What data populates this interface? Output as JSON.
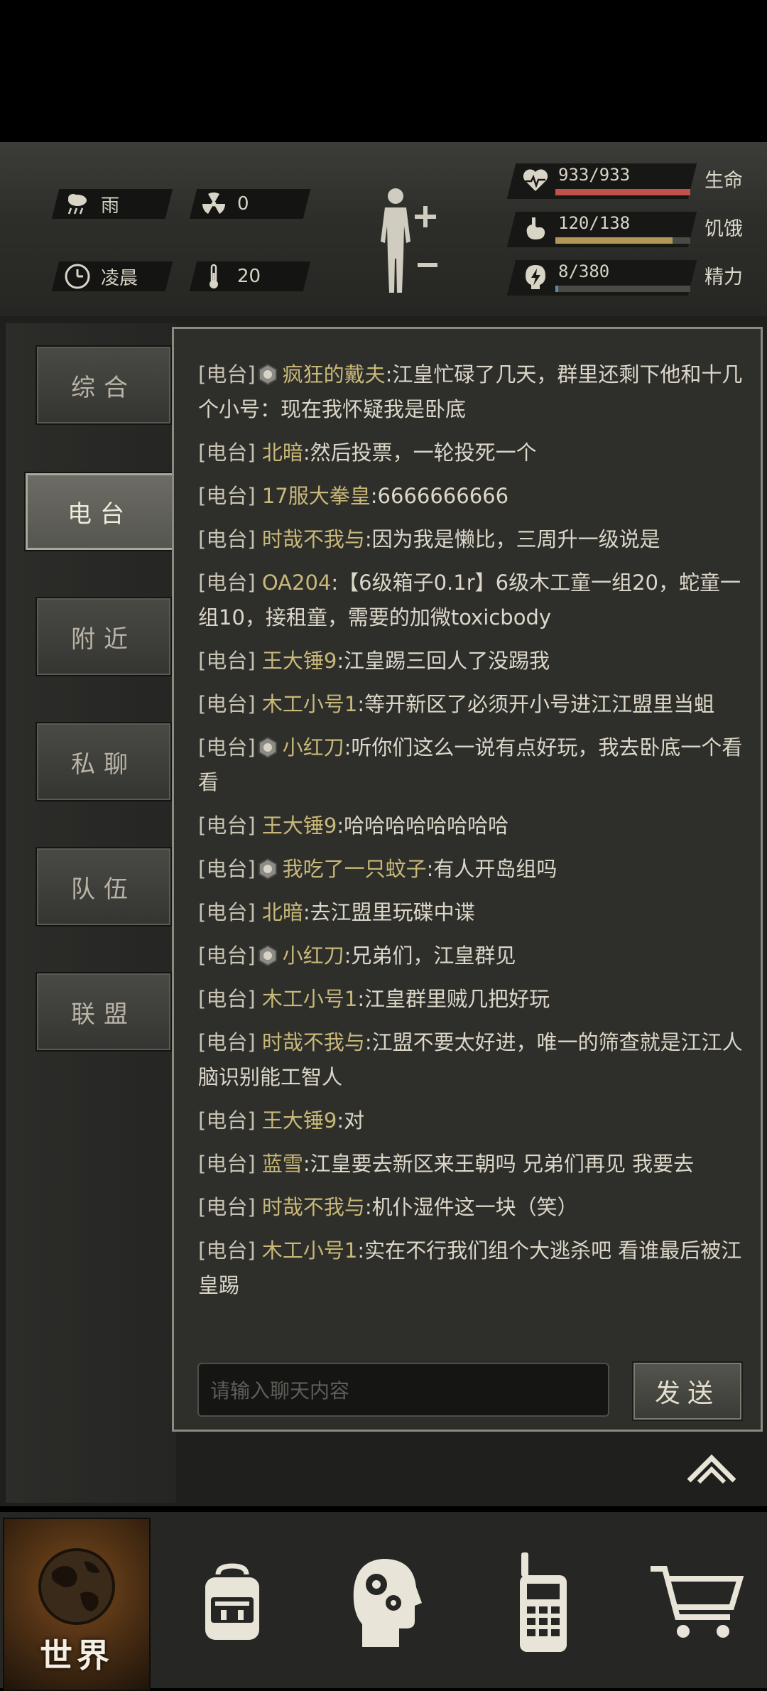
{
  "hud": {
    "weather": {
      "label": "雨",
      "icon": "rain-icon"
    },
    "radiation": {
      "value": "0",
      "icon": "radiation-icon"
    },
    "time_of_day": {
      "label": "凌晨",
      "icon": "clock-icon"
    },
    "temperature": {
      "value": "20",
      "icon": "thermometer-icon"
    },
    "stats": [
      {
        "name": "生命",
        "value": "933/933",
        "fraction": 1.0,
        "color": "#c0524a",
        "icon": "heart-pulse-icon"
      },
      {
        "name": "饥饿",
        "value": "120/138",
        "fraction": 0.87,
        "color": "#b39658",
        "icon": "stomach-icon"
      },
      {
        "name": "精力",
        "value": "8/380",
        "fraction": 0.02,
        "color": "#5a8ab0",
        "icon": "energy-icon"
      }
    ]
  },
  "tabs": [
    {
      "label": "综合",
      "active": false
    },
    {
      "label": "电台",
      "active": true
    },
    {
      "label": "附近",
      "active": false
    },
    {
      "label": "私聊",
      "active": false
    },
    {
      "label": "队伍",
      "active": false
    },
    {
      "label": "联盟",
      "active": false
    }
  ],
  "chat": {
    "channel": "[电台]",
    "messages": [
      {
        "name": "疯狂的戴夫",
        "text": ":江皇忙碌了几天，群里还剩下他和十几个小号：现在我怀疑我是卧底",
        "badge": true
      },
      {
        "name": "北暗",
        "text": ":然后投票，一轮投死一个",
        "badge": false
      },
      {
        "name": "17服大拳皇",
        "text": ":6666666666",
        "badge": false
      },
      {
        "name": "时哉不我与",
        "text": ":因为我是懒比，三周升一级说是",
        "badge": false
      },
      {
        "name": "OA204",
        "text": ":【6级箱子0.1r】6级木工童一组20，蛇童一组10，接租童，需要的加微toxicbody",
        "badge": false
      },
      {
        "name": "王大锤9",
        "text": ":江皇踢三回人了没踢我",
        "badge": false
      },
      {
        "name": "木工小号1",
        "text": ":等开新区了必须开小号进江江盟里当蛆",
        "badge": false
      },
      {
        "name": "小红刀",
        "text": ":听你们这么一说有点好玩，我去卧底一个看看",
        "badge": true
      },
      {
        "name": "王大锤9",
        "text": ":哈哈哈哈哈哈哈哈",
        "badge": false
      },
      {
        "name": "我吃了一只蚊子",
        "text": ":有人开岛组吗",
        "badge": true
      },
      {
        "name": "北暗",
        "text": ":去江盟里玩碟中谍",
        "badge": false
      },
      {
        "name": "小红刀",
        "text": ":兄弟们，江皇群见",
        "badge": true
      },
      {
        "name": "木工小号1",
        "text": ":江皇群里贼几把好玩",
        "badge": false
      },
      {
        "name": "时哉不我与",
        "text": ":江盟不要太好进，唯一的筛查就是江江人脑识别能工智人",
        "badge": false
      },
      {
        "name": "王大锤9",
        "text": ":对",
        "badge": false
      },
      {
        "name": "蓝雪",
        "text": ":江皇要去新区来王朝吗 兄弟们再见 我要去",
        "badge": false
      },
      {
        "name": "时哉不我与",
        "text": ":机仆湿件这一块（笑）",
        "badge": false
      },
      {
        "name": "木工小号1",
        "text": ":实在不行我们组个大逃杀吧 看谁最后被江皇踢",
        "badge": false
      }
    ],
    "input_placeholder": "请输入聊天内容",
    "send_label": "发送"
  },
  "nav": [
    {
      "label": "世界",
      "icon": "globe-icon",
      "active": true
    },
    {
      "label": "",
      "icon": "backpack-icon",
      "active": false
    },
    {
      "label": "",
      "icon": "head-gears-icon",
      "active": false
    },
    {
      "label": "",
      "icon": "walkie-talkie-icon",
      "active": false
    },
    {
      "label": "",
      "icon": "cart-icon",
      "active": false
    }
  ]
}
